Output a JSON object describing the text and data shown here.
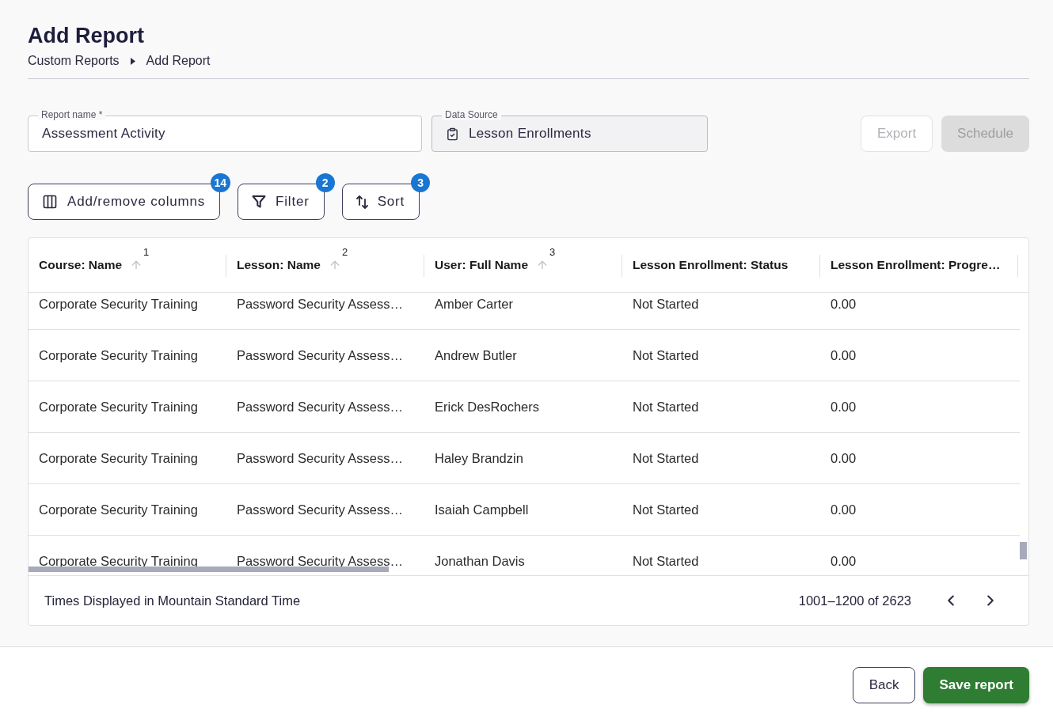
{
  "page": {
    "title": "Add Report"
  },
  "breadcrumb": [
    {
      "label": "Custom Reports"
    },
    {
      "label": "Add Report"
    }
  ],
  "form": {
    "report_name": {
      "label": "Report name *",
      "value": "Assessment Activity",
      "disabled": false
    },
    "data_source": {
      "label": "Data Source",
      "value": "Lesson Enrollments",
      "disabled": true
    }
  },
  "actions": [
    {
      "label": "Export",
      "kind": "outlined",
      "disabled": true
    },
    {
      "label": "Schedule",
      "kind": "contained",
      "disabled": true
    }
  ],
  "toolbar": [
    {
      "kind": "columns",
      "label": "Add/remove columns",
      "badge": "14"
    },
    {
      "kind": "filter",
      "label": "Filter",
      "badge": "2"
    },
    {
      "kind": "sort",
      "label": "Sort",
      "badge": "3"
    }
  ],
  "table": {
    "columns": [
      {
        "label": "Course: Name",
        "sorted": true,
        "sort_rank": "1"
      },
      {
        "label": "Lesson: Name",
        "sorted": true,
        "sort_rank": "2"
      },
      {
        "label": "User: Full Name",
        "sorted": true,
        "sort_rank": "3"
      },
      {
        "label": "Lesson Enrollment: Status",
        "sorted": false
      },
      {
        "label": "Lesson Enrollment: Progre…",
        "sorted": false
      }
    ],
    "rows": [
      [
        "Corporate Security Training",
        "Password Security Assess…",
        "Amber Carter",
        "Not Started",
        "0.00"
      ],
      [
        "Corporate Security Training",
        "Password Security Assess…",
        "Andrew Butler",
        "Not Started",
        "0.00"
      ],
      [
        "Corporate Security Training",
        "Password Security Assess…",
        "Erick DesRochers",
        "Not Started",
        "0.00"
      ],
      [
        "Corporate Security Training",
        "Password Security Assess…",
        "Haley Brandzin",
        "Not Started",
        "0.00"
      ],
      [
        "Corporate Security Training",
        "Password Security Assess…",
        "Isaiah Campbell",
        "Not Started",
        "0.00"
      ],
      [
        "Corporate Security Training",
        "Password Security Assess…",
        "Jonathan Davis",
        "Not Started",
        "0.00"
      ]
    ],
    "footer": {
      "note": "Times Displayed in Mountain Standard Time",
      "range": "1001–1200 of 2623"
    }
  },
  "footer_actions": [
    {
      "label": "Back",
      "kind": "outlined",
      "disabled": false
    },
    {
      "label": "Save report",
      "kind": "contained",
      "disabled": false
    }
  ]
}
